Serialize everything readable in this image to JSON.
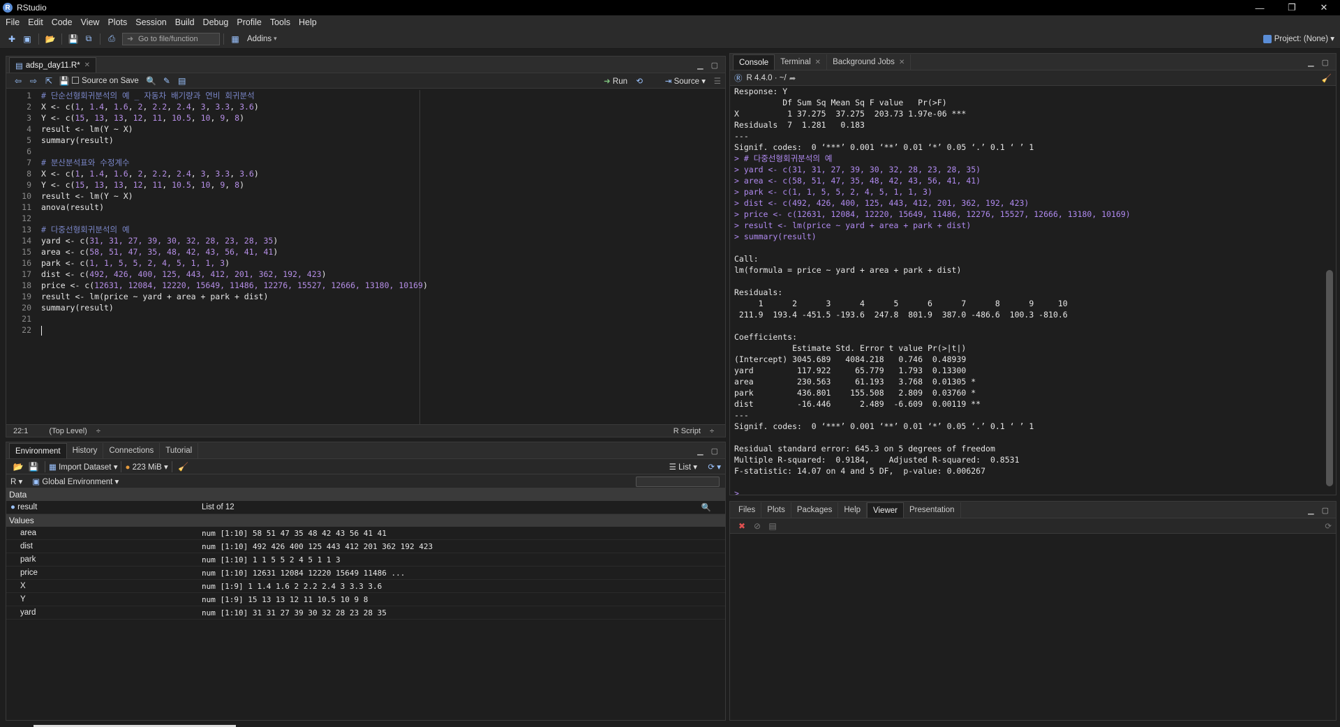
{
  "window": {
    "title": "RStudio"
  },
  "menu": [
    "File",
    "Edit",
    "Code",
    "View",
    "Plots",
    "Session",
    "Build",
    "Debug",
    "Profile",
    "Tools",
    "Help"
  ],
  "toolbar": {
    "goto_placeholder": "Go to file/function",
    "addins": "Addins",
    "project": "Project: (None)"
  },
  "editor": {
    "tab": "adsp_day11.R*",
    "source_on_save": "Source on Save",
    "run": "Run",
    "source": "Source",
    "lines": [
      [
        {
          "t": "# 단순선형회귀분석의 예 _ 자동차 배기량과 연비 회귀분석",
          "c": "cmt"
        }
      ],
      [
        {
          "t": "X <- c("
        },
        {
          "t": "1",
          "c": "num"
        },
        {
          "t": ", "
        },
        {
          "t": "1.4",
          "c": "num"
        },
        {
          "t": ", "
        },
        {
          "t": "1.6",
          "c": "num"
        },
        {
          "t": ", "
        },
        {
          "t": "2",
          "c": "num"
        },
        {
          "t": ", "
        },
        {
          "t": "2.2",
          "c": "num"
        },
        {
          "t": ", "
        },
        {
          "t": "2.4",
          "c": "num"
        },
        {
          "t": ", "
        },
        {
          "t": "3",
          "c": "num"
        },
        {
          "t": ", "
        },
        {
          "t": "3.3",
          "c": "num"
        },
        {
          "t": ", "
        },
        {
          "t": "3.6",
          "c": "num"
        },
        {
          "t": ")"
        }
      ],
      [
        {
          "t": "Y <- c("
        },
        {
          "t": "15",
          "c": "num"
        },
        {
          "t": ", "
        },
        {
          "t": "13",
          "c": "num"
        },
        {
          "t": ", "
        },
        {
          "t": "13",
          "c": "num"
        },
        {
          "t": ", "
        },
        {
          "t": "12",
          "c": "num"
        },
        {
          "t": ", "
        },
        {
          "t": "11",
          "c": "num"
        },
        {
          "t": ", "
        },
        {
          "t": "10.5",
          "c": "num"
        },
        {
          "t": ", "
        },
        {
          "t": "10",
          "c": "num"
        },
        {
          "t": ", "
        },
        {
          "t": "9",
          "c": "num"
        },
        {
          "t": ", "
        },
        {
          "t": "8",
          "c": "num"
        },
        {
          "t": ")"
        }
      ],
      [
        {
          "t": "result <- lm(Y ~ X)"
        }
      ],
      [
        {
          "t": "summary(result)"
        }
      ],
      [
        {
          "t": ""
        }
      ],
      [
        {
          "t": "# 분산분석표와 수정계수",
          "c": "cmt"
        }
      ],
      [
        {
          "t": "X <- c("
        },
        {
          "t": "1",
          "c": "num"
        },
        {
          "t": ", "
        },
        {
          "t": "1.4",
          "c": "num"
        },
        {
          "t": ", "
        },
        {
          "t": "1.6",
          "c": "num"
        },
        {
          "t": ", "
        },
        {
          "t": "2",
          "c": "num"
        },
        {
          "t": ", "
        },
        {
          "t": "2.2",
          "c": "num"
        },
        {
          "t": ", "
        },
        {
          "t": "2.4",
          "c": "num"
        },
        {
          "t": ", "
        },
        {
          "t": "3",
          "c": "num"
        },
        {
          "t": ", "
        },
        {
          "t": "3.3",
          "c": "num"
        },
        {
          "t": ", "
        },
        {
          "t": "3.6",
          "c": "num"
        },
        {
          "t": ")"
        }
      ],
      [
        {
          "t": "Y <- c("
        },
        {
          "t": "15",
          "c": "num"
        },
        {
          "t": ", "
        },
        {
          "t": "13",
          "c": "num"
        },
        {
          "t": ", "
        },
        {
          "t": "13",
          "c": "num"
        },
        {
          "t": ", "
        },
        {
          "t": "12",
          "c": "num"
        },
        {
          "t": ", "
        },
        {
          "t": "11",
          "c": "num"
        },
        {
          "t": ", "
        },
        {
          "t": "10.5",
          "c": "num"
        },
        {
          "t": ", "
        },
        {
          "t": "10",
          "c": "num"
        },
        {
          "t": ", "
        },
        {
          "t": "9",
          "c": "num"
        },
        {
          "t": ", "
        },
        {
          "t": "8",
          "c": "num"
        },
        {
          "t": ")"
        }
      ],
      [
        {
          "t": "result <- lm(Y ~ X)"
        }
      ],
      [
        {
          "t": "anova(result)"
        }
      ],
      [
        {
          "t": ""
        }
      ],
      [
        {
          "t": "# 다중선형회귀분석의 예",
          "c": "cmt"
        }
      ],
      [
        {
          "t": "yard <- c("
        },
        {
          "t": "31, 31, 27, 39, 30, 32, 28, 23, 28, 35",
          "c": "num"
        },
        {
          "t": ")"
        }
      ],
      [
        {
          "t": "area <- c("
        },
        {
          "t": "58, 51, 47, 35, 48, 42, 43, 56, 41, 41",
          "c": "num"
        },
        {
          "t": ")"
        }
      ],
      [
        {
          "t": "park <- c("
        },
        {
          "t": "1, 1, 5, 5, 2, 4, 5, 1, 1, 3",
          "c": "num"
        },
        {
          "t": ")"
        }
      ],
      [
        {
          "t": "dist <- c("
        },
        {
          "t": "492, 426, 400, 125, 443, 412, 201, 362, 192, 423",
          "c": "num"
        },
        {
          "t": ")"
        }
      ],
      [
        {
          "t": "price <- c("
        },
        {
          "t": "12631, 12084, 12220, 15649, 11486, 12276, 15527, 12666, 13180, 10169",
          "c": "num"
        },
        {
          "t": ")"
        }
      ],
      [
        {
          "t": "result <- lm(price ~ yard + area + park + dist)"
        }
      ],
      [
        {
          "t": "summary(result)"
        }
      ],
      [
        {
          "t": ""
        }
      ],
      [
        {
          "t": ""
        }
      ]
    ],
    "status_pos": "22:1",
    "status_scope": "(Top Level)",
    "status_type": "R Script"
  },
  "environment": {
    "tabs": [
      "Environment",
      "History",
      "Connections",
      "Tutorial"
    ],
    "import_dataset": "Import Dataset",
    "memory": "223 MiB",
    "view_mode": "List",
    "lang": "R",
    "scope": "Global Environment",
    "section_data": "Data",
    "data_rows": [
      {
        "name": "result",
        "value": "List of  12"
      }
    ],
    "section_values": "Values",
    "value_rows": [
      {
        "name": "area",
        "value": "num [1:10] 58 51 47 35 48 42 43 56 41 41"
      },
      {
        "name": "dist",
        "value": "num [1:10] 492 426 400 125 443 412 201 362 192 423"
      },
      {
        "name": "park",
        "value": "num [1:10] 1 1 5 5 2 4 5 1 1 3"
      },
      {
        "name": "price",
        "value": "num [1:10] 12631 12084 12220 15649 11486 ..."
      },
      {
        "name": "X",
        "value": "num [1:9] 1 1.4 1.6 2 2.2 2.4 3 3.3 3.6"
      },
      {
        "name": "Y",
        "value": "num [1:9] 15 13 13 12 11 10.5 10 9 8"
      },
      {
        "name": "yard",
        "value": "num [1:10] 31 31 27 39 30 32 28 23 28 35"
      }
    ]
  },
  "console": {
    "tabs": [
      "Console",
      "Terminal",
      "Background Jobs"
    ],
    "version": "R 4.4.0 · ~/",
    "lines": [
      {
        "t": "Response: Y"
      },
      {
        "t": "          Df Sum Sq Mean Sq F value   Pr(>F)    "
      },
      {
        "t": "X          1 37.275  37.275  203.73 1.97e-06 ***"
      },
      {
        "t": "Residuals  7  1.281   0.183                     "
      },
      {
        "t": "---"
      },
      {
        "t": "Signif. codes:  0 ‘***’ 0.001 ‘**’ 0.01 ‘*’ 0.05 ‘.’ 0.1 ‘ ’ 1"
      },
      {
        "t": "> # 다중선형회귀분석의 예",
        "c": "cmd"
      },
      {
        "t": "> yard <- c(31, 31, 27, 39, 30, 32, 28, 23, 28, 35)",
        "c": "cmd"
      },
      {
        "t": "> area <- c(58, 51, 47, 35, 48, 42, 43, 56, 41, 41)",
        "c": "cmd"
      },
      {
        "t": "> park <- c(1, 1, 5, 5, 2, 4, 5, 1, 1, 3)",
        "c": "cmd"
      },
      {
        "t": "> dist <- c(492, 426, 400, 125, 443, 412, 201, 362, 192, 423)",
        "c": "cmd"
      },
      {
        "t": "> price <- c(12631, 12084, 12220, 15649, 11486, 12276, 15527, 12666, 13180, 10169)",
        "c": "cmd"
      },
      {
        "t": "> result <- lm(price ~ yard + area + park + dist)",
        "c": "cmd"
      },
      {
        "t": "> summary(result)",
        "c": "cmd"
      },
      {
        "t": ""
      },
      {
        "t": "Call:"
      },
      {
        "t": "lm(formula = price ~ yard + area + park + dist)"
      },
      {
        "t": ""
      },
      {
        "t": "Residuals:"
      },
      {
        "t": "     1      2      3      4      5      6      7      8      9     10 "
      },
      {
        "t": " 211.9  193.4 -451.5 -193.6  247.8  801.9  387.0 -486.6  100.3 -810.6 "
      },
      {
        "t": ""
      },
      {
        "t": "Coefficients:"
      },
      {
        "t": "            Estimate Std. Error t value Pr(>|t|)   "
      },
      {
        "t": "(Intercept) 3045.689   4084.218   0.746  0.48939   "
      },
      {
        "t": "yard         117.922     65.779   1.793  0.13300   "
      },
      {
        "t": "area         230.563     61.193   3.768  0.01305 * "
      },
      {
        "t": "park         436.801    155.508   2.809  0.03760 * "
      },
      {
        "t": "dist         -16.446      2.489  -6.609  0.00119 **"
      },
      {
        "t": "---"
      },
      {
        "t": "Signif. codes:  0 ‘***’ 0.001 ‘**’ 0.01 ‘*’ 0.05 ‘.’ 0.1 ‘ ’ 1"
      },
      {
        "t": ""
      },
      {
        "t": "Residual standard error: 645.3 on 5 degrees of freedom"
      },
      {
        "t": "Multiple R-squared:  0.9184,\tAdjusted R-squared:  0.8531 "
      },
      {
        "t": "F-statistic: 14.07 on 4 and 5 DF,  p-value: 0.006267"
      },
      {
        "t": ""
      },
      {
        "t": "> ",
        "c": "cmd"
      }
    ]
  },
  "viewer": {
    "tabs": [
      "Files",
      "Plots",
      "Packages",
      "Help",
      "Viewer",
      "Presentation"
    ]
  }
}
